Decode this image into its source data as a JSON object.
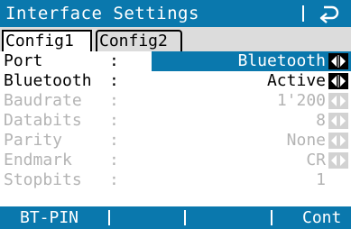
{
  "title": "Interface Settings",
  "tabs": [
    {
      "label": "Config1",
      "active": true
    },
    {
      "label": "Config2",
      "active": false
    }
  ],
  "fields": [
    {
      "label": "Port",
      "value": "Bluetooth",
      "enabled": true
    },
    {
      "label": "Bluetooth",
      "value": "Active",
      "enabled": true
    },
    {
      "label": "Baudrate",
      "value": "1'200",
      "enabled": false
    },
    {
      "label": "Databits",
      "value": "8",
      "enabled": false
    },
    {
      "label": "Parity",
      "value": "None",
      "enabled": false
    },
    {
      "label": "Endmark",
      "value": "CR",
      "enabled": false
    },
    {
      "label": "Stopbits",
      "value": "1",
      "enabled": false
    }
  ],
  "softkeys": [
    {
      "label": "BT-PIN"
    },
    {
      "label": ""
    },
    {
      "label": ""
    },
    {
      "label": "Cont"
    }
  ],
  "colors": {
    "accent": "#0a78ad",
    "disabled_text": "#b4b4b4",
    "tab_bar": "#dcdcdc"
  },
  "icons": {
    "back": "return-arrow-icon",
    "selector": "left-right-arrow-icon"
  }
}
